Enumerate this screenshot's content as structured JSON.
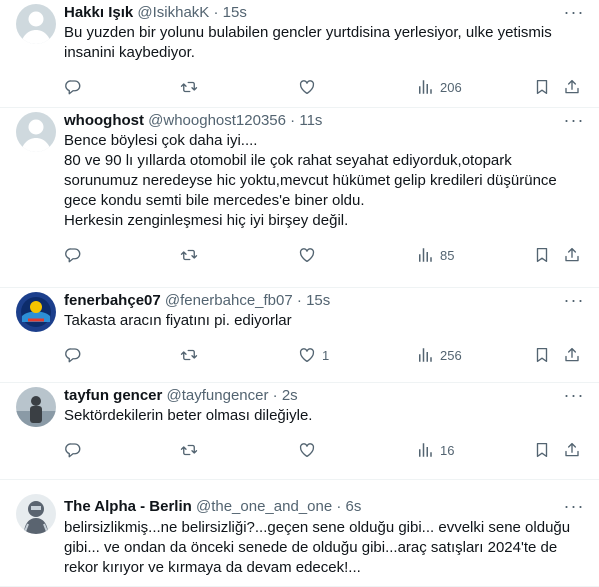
{
  "tweets": [
    {
      "name": "Hakkı Işık",
      "handle": "@IsikhakK",
      "time": "15s",
      "lines": [
        "Bu yuzden bir yolunu bulabilen gencler yurtdisina yerlesiyor, ulke yetismis",
        "insanini kaybediyor."
      ],
      "replies": "",
      "retweets": "",
      "likes": "",
      "views": "206",
      "avatar": {
        "bg": "#cfd9de",
        "fg": "#ffffff"
      }
    },
    {
      "name": "whooghost",
      "handle": "@whooghost120356",
      "time": "11s",
      "lines": [
        "Bence böylesi çok daha iyi....",
        "80 ve 90 lı yıllarda otomobil ile çok rahat seyahat ediyorduk,otopark",
        "sorunumuz neredeyse hic yoktu,mevcut hükümet gelip kredileri düşürünce",
        "gece kondu semti bile mercedes'e biner oldu.",
        "Herkesin zenginleşmesi hiç iyi birşey değil."
      ],
      "replies": "",
      "retweets": "",
      "likes": "",
      "views": "85",
      "avatar": {
        "bg": "#cfd9de",
        "fg": "#ffffff"
      }
    },
    {
      "name": "fenerbahçe07",
      "handle": "@fenerbahce_fb07",
      "time": "15s",
      "lines": [
        "Takasta aracın fiyatını pi. ediyorlar"
      ],
      "replies": "",
      "retweets": "",
      "likes": "1",
      "views": "256",
      "avatar": {
        "bg": "#1c3f8c",
        "fg": "#f5c400"
      }
    },
    {
      "name": "tayfun gencer",
      "handle": "@tayfungencer",
      "time": "2s",
      "lines": [
        "Sektördekilerin beter olması dileğiyle."
      ],
      "replies": "",
      "retweets": "",
      "likes": "",
      "views": "16",
      "avatar": {
        "bg": "#b8c4cc",
        "fg": "#3a3f44"
      }
    },
    {
      "name": "The Alpha - Berlin",
      "handle": "@the_one_and_one",
      "time": "6s",
      "lines": [
        "belirsizlikmiş...ne belirsizliği?...geçen sene olduğu gibi... evvelki sene olduğu",
        "gibi... ve ondan da önceki senede de olduğu gibi...araç satışları 2024'te de",
        "rekor kırıyor ve kırmaya da devam edecek!..."
      ],
      "replies": "",
      "retweets": "",
      "likes": "",
      "views": "",
      "avatar": {
        "bg": "#5a6470",
        "fg": "#c9d2da"
      }
    }
  ],
  "sep": "·",
  "icons": {
    "more": "more-horizontal-icon",
    "reply": "reply-icon",
    "retweet": "retweet-icon",
    "like": "heart-icon",
    "views": "views-chart-icon",
    "bookmark": "bookmark-icon",
    "share": "share-icon"
  }
}
